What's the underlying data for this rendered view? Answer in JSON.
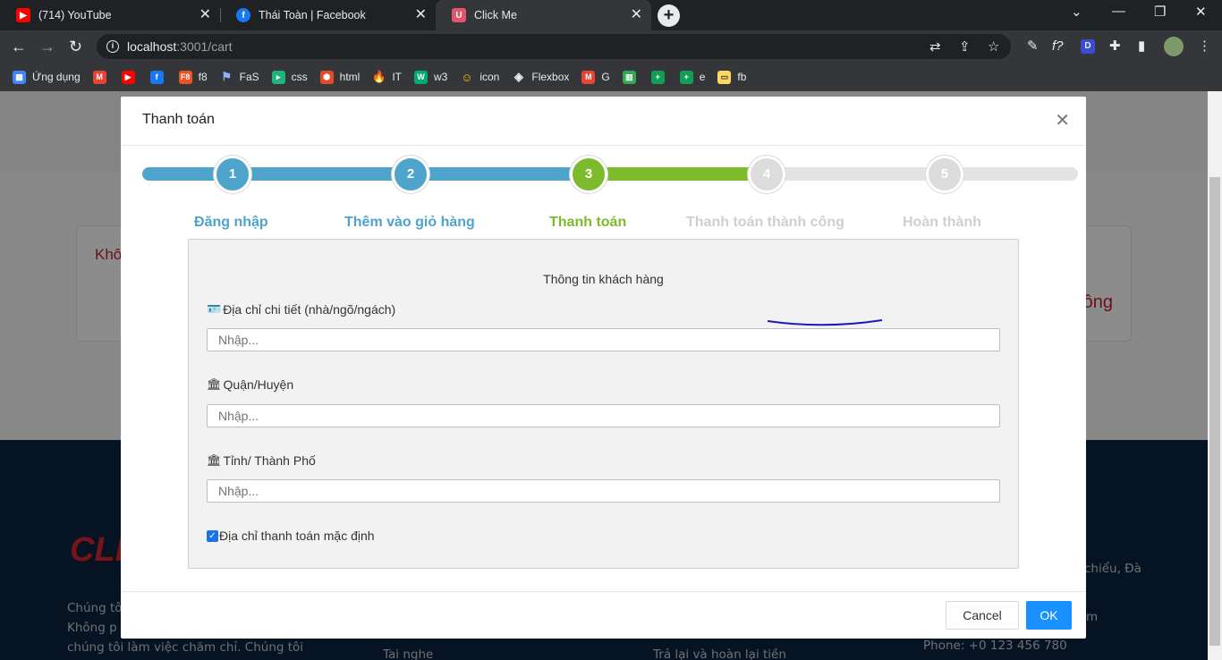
{
  "browser": {
    "tabs": [
      {
        "title": "(714) YouTube",
        "icon": "youtube-icon",
        "color": "#ff0000"
      },
      {
        "title": "Thái Toàn | Facebook",
        "icon": "facebook-icon",
        "color": "#1877f2"
      },
      {
        "title": "Click Me",
        "icon": "clickme-icon",
        "color": "#e0566b"
      }
    ],
    "url_host": "localhost",
    "url_path": ":3001/cart",
    "bookmarks": [
      {
        "label": "Ứng dụng",
        "icon": "apps-grid-icon",
        "color": "#4285f4"
      },
      {
        "label": "",
        "icon": "gmail-icon",
        "color": "#ea4335"
      },
      {
        "label": "",
        "icon": "youtube-icon",
        "color": "#ff0000"
      },
      {
        "label": "",
        "icon": "facebook-icon",
        "color": "#1877f2"
      },
      {
        "label": "f8",
        "icon": "f8-icon",
        "color": "#f05123"
      },
      {
        "label": "FaS",
        "icon": "flag-icon",
        "color": "#8ab4f8"
      },
      {
        "label": "css",
        "icon": "css-icon",
        "color": "#1fb57a"
      },
      {
        "label": "html",
        "icon": "html-icon",
        "color": "#e34c26"
      },
      {
        "label": "IT",
        "icon": "fire-icon",
        "color": "#f4511e"
      },
      {
        "label": "w3",
        "icon": "w3-icon",
        "color": "#04aa6d"
      },
      {
        "label": "icon",
        "icon": "emoji-icon",
        "color": "#f7c815"
      },
      {
        "label": "Flexbox",
        "icon": "flexbox-icon",
        "color": "#e8eaed"
      },
      {
        "label": "G",
        "icon": "gmail-icon",
        "color": "#ea4335"
      },
      {
        "label": "",
        "icon": "chart-icon",
        "color": "#34a853"
      },
      {
        "label": "",
        "icon": "sheets-icon",
        "color": "#0f9d58"
      },
      {
        "label": "e",
        "icon": "sheets-icon",
        "color": "#0f9d58"
      },
      {
        "label": "fb",
        "icon": "folder-icon",
        "color": "#fdd663"
      }
    ]
  },
  "modal": {
    "title": "Thanh toán",
    "close_icon": "close-icon",
    "steps": [
      {
        "number": "1",
        "label": "Đăng nhập",
        "status": "done",
        "color": "#4fa4cb"
      },
      {
        "number": "2",
        "label": "Thêm vào giỏ hàng",
        "status": "done",
        "color": "#4fa4cb"
      },
      {
        "number": "3",
        "label": "Thanh toán",
        "status": "current",
        "color": "#7dbb2c"
      },
      {
        "number": "4",
        "label": "Thanh toán thành công",
        "status": "pending",
        "color": "#dcdcdc"
      },
      {
        "number": "5",
        "label": "Hoàn thành",
        "status": "pending",
        "color": "#dcdcdc"
      }
    ],
    "form": {
      "heading": "Thông tin khách hàng",
      "address": {
        "label": "Địa chỉ chi tiết (nhà/ngõ/ngách)",
        "placeholder": "Nhập...",
        "icon": "id-card-icon"
      },
      "district": {
        "label": "Quận/Huyện",
        "placeholder": "Nhập...",
        "icon": "bank-icon"
      },
      "city": {
        "label": "Tỉnh/ Thành Phố",
        "placeholder": "Nhập...",
        "icon": "bank-icon"
      },
      "default_address": {
        "label": "Địa chỉ thanh toán mặc định",
        "checked": true
      }
    },
    "cancel_label": "Cancel",
    "ok_label": "OK"
  },
  "background": {
    "card_text_left": "Khô",
    "card_text_right": "ông",
    "footer_logo": "CLI",
    "footer_text": [
      "Chúng tô",
      "Không p",
      "chúng tôi làm việc chăm chỉ. Chúng tôi"
    ],
    "footer_col2": "Tai nghe",
    "footer_col3": "Trả lại và hoàn lại tiền",
    "footer_contact_1": "chiểu, Đà",
    "footer_contact_2": "m",
    "footer_phone": "Phone: +0 123 456 780"
  }
}
